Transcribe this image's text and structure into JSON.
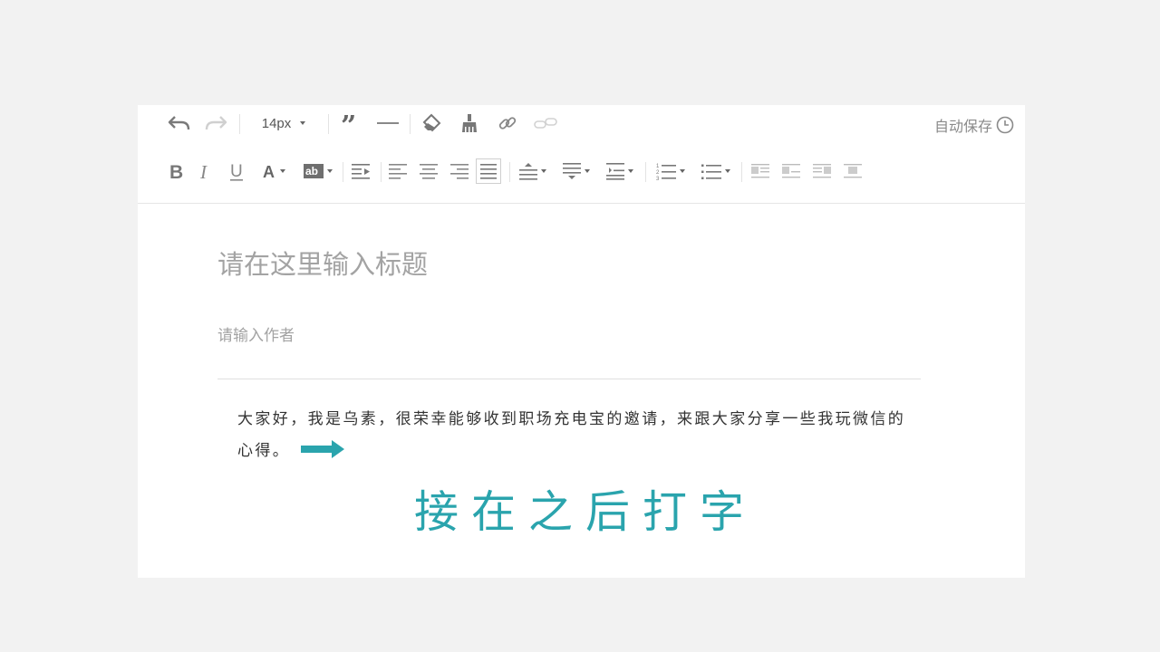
{
  "toolbar": {
    "font_size": "14px",
    "autosave_label": "自动保存",
    "icons_row1": [
      "undo-icon",
      "redo-icon",
      "quote-icon",
      "horizontal-rule-icon",
      "eraser-icon",
      "format-brush-icon",
      "link-icon",
      "unlink-icon"
    ],
    "icons_row2": [
      "bold-icon",
      "italic-icon",
      "underline-icon",
      "font-color-icon",
      "background-color-icon",
      "indent-icon",
      "align-left-icon",
      "align-center-icon",
      "align-right-icon",
      "align-justify-icon",
      "spacing-before-icon",
      "spacing-after-icon",
      "line-height-icon",
      "ordered-list-icon",
      "unordered-list-icon",
      "image-left-icon",
      "image-none-icon",
      "image-right-icon",
      "image-center-icon"
    ]
  },
  "editor": {
    "title_placeholder": "请在这里输入标题",
    "author_placeholder": "请输入作者",
    "body_text_1": "大家好，我是乌素，很荣幸能够收到职场充电宝的邀请，来跟大家分享一些我玩微信的心得。"
  },
  "annotation": {
    "hint": "接在之后打字",
    "accent_color": "#2aa4ad"
  }
}
